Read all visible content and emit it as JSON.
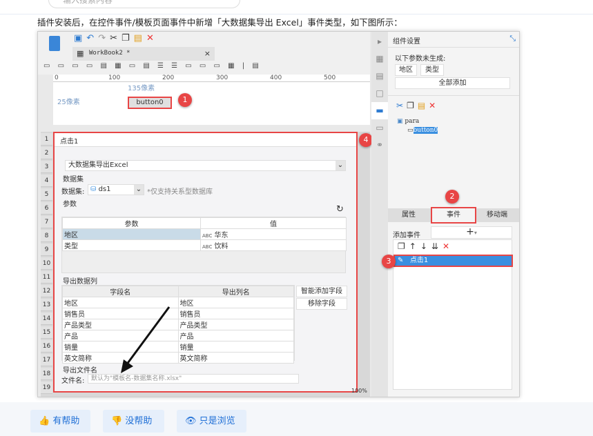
{
  "search": {
    "placeholder": "输入搜索内容"
  },
  "intro": "插件安装后，在控件事件/模板页面事件中新增「大数据集导出 Excel」事件类型，如下图所示：",
  "designer": {
    "tab": "WorkBook2 *",
    "ruler": [
      "0",
      "100",
      "200",
      "300",
      "400",
      "500"
    ],
    "canvas": {
      "top_label": "135像素",
      "left_label": "25像素",
      "button": "button0"
    },
    "badges": [
      "1",
      "2",
      "3",
      "4"
    ],
    "rows": [
      "1",
      "2",
      "3",
      "4",
      "5",
      "6",
      "7",
      "8",
      "9",
      "10",
      "11",
      "12",
      "13",
      "14",
      "15",
      "16",
      "17",
      "18",
      "19"
    ],
    "status_zoom": "100%",
    "dialog": {
      "title": "点击1",
      "event_type": "大数据集导出Excel",
      "dataset_section": "数据集",
      "dataset_label": "数据集:",
      "dataset_value": "ds1",
      "dataset_hint": "*仅支持关系型数据库",
      "params_section": "参数",
      "params_headers": [
        "参数",
        "值"
      ],
      "params": [
        {
          "name": "地区",
          "value": "华东"
        },
        {
          "name": "类型",
          "value": "饮料"
        }
      ],
      "export_section": "导出数据列",
      "export_headers": [
        "字段名",
        "导出列名"
      ],
      "export_rows": [
        [
          "地区",
          "地区"
        ],
        [
          "销售员",
          "销售员"
        ],
        [
          "产品类型",
          "产品类型"
        ],
        [
          "产品",
          "产品"
        ],
        [
          "销量",
          "销量"
        ],
        [
          "英文简称",
          "英文简称"
        ]
      ],
      "smart_add": "智能添加字段",
      "remove_field": "移除字段",
      "filename_section": "导出文件名",
      "filename_label": "文件名:",
      "filename_placeholder": "默认为\"模板名-数据集名称.xlsx\""
    },
    "panel": {
      "title": "组件设置",
      "params_not_generated": "以下参数未生成:",
      "param_buttons": [
        "地区",
        "类型"
      ],
      "add_all": "全部添加",
      "tree_root": "para",
      "tree_child": "button0",
      "tabs": [
        "属性",
        "事件",
        "移动端"
      ],
      "add_event": "添加事件",
      "event_item": "点击1"
    }
  },
  "feedback": {
    "helpful": "有帮助",
    "not_helpful": "没帮助",
    "just_browsing": "只是浏览"
  }
}
